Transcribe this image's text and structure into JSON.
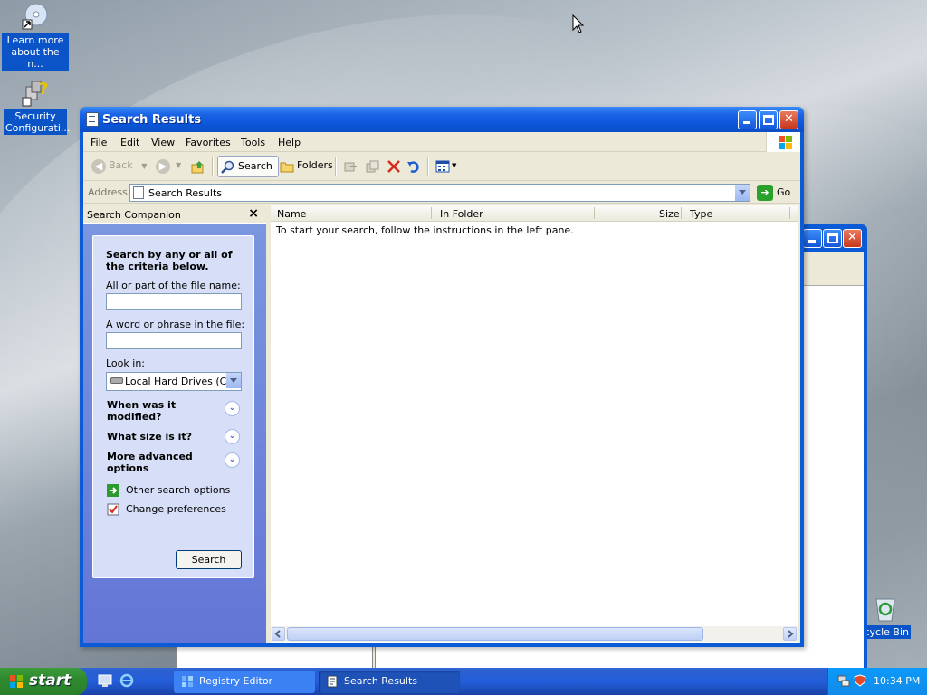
{
  "desktop": {
    "icons": [
      {
        "label": "Learn more about the n..."
      },
      {
        "label": "Security Configurati..."
      },
      {
        "label": "Recycle Bin"
      }
    ]
  },
  "window": {
    "title": "Search Results",
    "menu": [
      "File",
      "Edit",
      "View",
      "Favorites",
      "Tools",
      "Help"
    ],
    "toolbar": {
      "back": "Back",
      "search": "Search",
      "folders": "Folders"
    },
    "address": {
      "label": "Address",
      "value": "Search Results",
      "go": "Go"
    },
    "companion": {
      "title": "Search Companion",
      "close": "×",
      "heading": "Search by any or all of the criteria below.",
      "filename_label": "All or part of the file name:",
      "filename_value": "",
      "phrase_label": "A word or phrase in the file:",
      "phrase_value": "",
      "lookin_label": "Look in:",
      "lookin_value": "Local Hard Drives (C:)",
      "when_modified": "When was it modified?",
      "what_size": "What size is it?",
      "more_advanced": "More advanced options",
      "other_options": "Other search options",
      "change_prefs": "Change preferences",
      "search_button": "Search"
    },
    "results": {
      "columns": [
        "Name",
        "In Folder",
        "Size",
        "Type"
      ],
      "message": "To start your search, follow the instructions in the left pane."
    }
  },
  "taskbar": {
    "start": "start",
    "buttons": [
      {
        "label": "Registry Editor",
        "active": false
      },
      {
        "label": "Search Results",
        "active": true
      }
    ],
    "clock": "10:34 PM"
  }
}
